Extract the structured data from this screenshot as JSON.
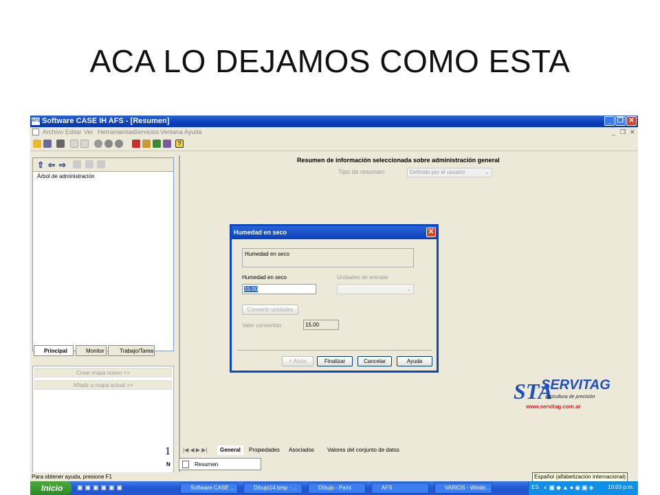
{
  "slide": {
    "title": "ACA LO DEJAMOS COMO ESTA"
  },
  "window": {
    "logo_text": "AFS",
    "title": "Software CASE IH AFS - [Resumen]",
    "menu": [
      "Archivo",
      "Editar",
      "Ver",
      "Herramientas",
      "Servicios",
      "Ventana",
      "Ayuda"
    ]
  },
  "left_panel": {
    "tree_root": "Árbol de administración",
    "tabs": [
      "Principal",
      "Monitor",
      "Trabajo/Tarea"
    ],
    "create_map": "Crear mapa nuevo  >>",
    "add_map": "Añadir a mapa actual  >>",
    "compass_number": "1",
    "compass_letter": "N"
  },
  "summary": {
    "heading": "Resumen de información seleccionada sobre administración general",
    "type_label": "Tipo de resumen",
    "type_value": "Definido por el usuario"
  },
  "dialog": {
    "title": "Humedad en seco",
    "group_text": "Humedad en seco",
    "field_label": "Humedad en seco",
    "field_value": "15.00",
    "units_label": "Unidades de entrada",
    "convert_button": "Convertir unidades",
    "converted_label": "Valor convertido",
    "converted_value": "15.00",
    "back_button": "< Atrás",
    "finish_button": "Finalizar",
    "cancel_button": "Cancelar",
    "help_button": "Ayuda"
  },
  "bottom_tabs": [
    "General",
    "Propiedades",
    "Asociados",
    "Valores del conjunto de datos"
  ],
  "doc_tab": "Resumen",
  "status": {
    "help_text": "Para obtener ayuda, presione F1",
    "language_tip": "Español (alfabetización internacional)"
  },
  "taskbar": {
    "start": "Inicio",
    "tasks": [
      "Software CASE ...",
      "Dibujo14.bmp - ...",
      "Dibujo - Paint",
      "AFS",
      "VARIOS - Windo..."
    ],
    "lang": "ES",
    "clock": "10:03 p.m."
  },
  "logo": {
    "name": "SERVITAG",
    "letters": "STA",
    "tagline": "agricultura de precisión",
    "url": "www.servitag.com.ar",
    "colors": {
      "blue": "#1d4fc4",
      "red": "#d8232a",
      "green": "#1f9a3a"
    }
  }
}
